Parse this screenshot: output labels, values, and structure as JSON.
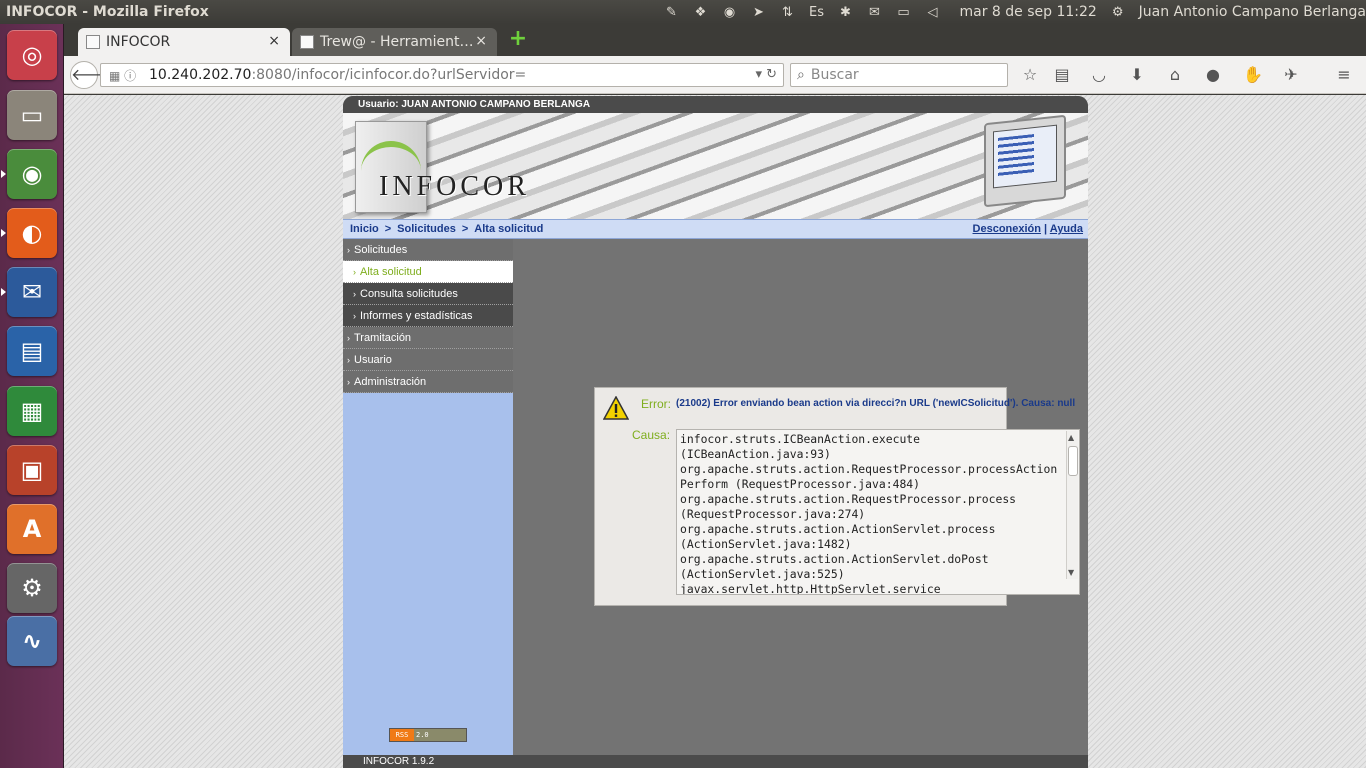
{
  "system": {
    "window_title": "INFOCOR - Mozilla Firefox",
    "clock": "mar  8 de sep 11:22",
    "user": "Juan Antonio Campano Berlanga"
  },
  "launcher": {
    "items": [
      {
        "name": "ubuntu-dash-icon",
        "glyph": "◎",
        "color": "#c8404a"
      },
      {
        "name": "files-icon",
        "glyph": "▭",
        "color": "#8b857a"
      },
      {
        "name": "chrome-icon",
        "glyph": "◉",
        "color": "#4a8c3c"
      },
      {
        "name": "firefox-icon",
        "glyph": "◐",
        "color": "#e35c1b"
      },
      {
        "name": "thunderbird-icon",
        "glyph": "✉",
        "color": "#2c5a9b"
      },
      {
        "name": "writer-icon",
        "glyph": "▤",
        "color": "#2a63a8"
      },
      {
        "name": "calc-icon",
        "glyph": "▦",
        "color": "#2f8a3b"
      },
      {
        "name": "impress-icon",
        "glyph": "▣",
        "color": "#b8422a"
      },
      {
        "name": "software-center-icon",
        "glyph": "A",
        "color": "#e0702a"
      },
      {
        "name": "system-settings-icon",
        "glyph": "⚙",
        "color": "#666666"
      },
      {
        "name": "system-monitor-icon",
        "glyph": "∿",
        "color": "#4a6fa5"
      }
    ]
  },
  "tabs": {
    "active": "INFOCOR",
    "inactive": "Trew@ - Herramient…",
    "close": "×",
    "new_tab": "+"
  },
  "navbar": {
    "url_host": "10.240.202.70",
    "url_rest": ":8080/infocor/icinfocor.do?urlServidor=",
    "search_placeholder": "Buscar"
  },
  "page": {
    "user_bar": "Usuario: JUAN ANTONIO CAMPANO BERLANGA",
    "banner_title": "INFOCOR",
    "breadcrumb": [
      "Inicio",
      "Solicitudes",
      "Alta solicitud"
    ],
    "links": {
      "logout": "Desconexión",
      "sep": "|",
      "help": "Ayuda"
    },
    "menu": [
      {
        "label": "Solicitudes",
        "type": "main"
      },
      {
        "label": "Alta solicitud",
        "type": "active"
      },
      {
        "label": "Consulta solicitudes",
        "type": "sub"
      },
      {
        "label": "Informes y estadísticas",
        "type": "sub"
      },
      {
        "label": "Tramitación",
        "type": "main"
      },
      {
        "label": "Usuario",
        "type": "main"
      },
      {
        "label": "Administración",
        "type": "main"
      }
    ],
    "rss": {
      "left": "RSS",
      "right": "2.0"
    },
    "footer": "INFOCOR 1.9.2"
  },
  "error": {
    "label": "Error:",
    "message": "(21002) Error enviando bean action via direcci?n URL ('newICSolicitud'). Causa: null",
    "cause_label": "Causa:",
    "cause_lines": [
      "infocor.struts.ICBeanAction.execute",
      "(ICBeanAction.java:93)",
      "org.apache.struts.action.RequestProcessor.processAction",
      "Perform (RequestProcessor.java:484)",
      "org.apache.struts.action.RequestProcessor.process",
      "(RequestProcessor.java:274)",
      "org.apache.struts.action.ActionServlet.process",
      "(ActionServlet.java:1482)",
      "org.apache.struts.action.ActionServlet.doPost",
      "(ActionServlet.java:525)",
      "javax.servlet.http.HttpServlet.service"
    ]
  }
}
